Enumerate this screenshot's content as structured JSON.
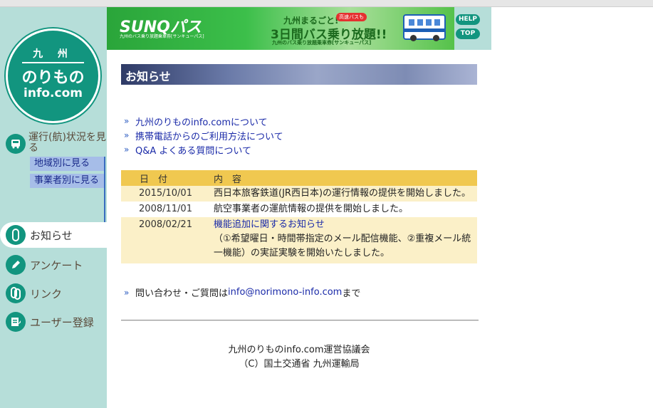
{
  "logo": {
    "line1": "九 州",
    "line2": "のりもの",
    "line3": "info.com"
  },
  "sidebar": {
    "operation": {
      "label": "運行(航)状況を見る",
      "subitems": [
        {
          "label": "地域別に見る"
        },
        {
          "label": "事業者別に見る"
        }
      ]
    },
    "menu": [
      {
        "label": "お知らせ",
        "active": true,
        "icon": "info-icon"
      },
      {
        "label": "アンケート",
        "active": false,
        "icon": "pencil-icon"
      },
      {
        "label": "リンク",
        "active": false,
        "icon": "link-icon"
      },
      {
        "label": "ユーザー登録",
        "active": false,
        "icon": "register-icon"
      }
    ]
  },
  "banner": {
    "brand": "SUNQパス",
    "brand_sub": "九州のバス乗り放題乗車券[サンキューパス]",
    "catch1": "九州まるごと!",
    "pill": "高速バスも",
    "catch2": "3日間バス乗り放題!!",
    "catch3": "九州のバス乗り放題乗車券[サンキューパス]",
    "help": "HELP",
    "top": "TOP"
  },
  "main": {
    "title": "お知らせ",
    "links": [
      {
        "label": "九州のりものinfo.comについて"
      },
      {
        "label": "携帯電話からのご利用方法について"
      },
      {
        "label": "Q&A よくある質問について"
      }
    ],
    "news": {
      "header_date": "日　付",
      "header_content": "内　容",
      "rows": [
        {
          "date": "2015/10/01",
          "content": "西日本旅客鉄道(JR西日本)の運行情報の提供を開始しました。"
        },
        {
          "date": "2008/11/01",
          "content": "航空事業者の運航情報の提供を開始しました。"
        },
        {
          "date": "2008/02/21",
          "link": "機能追加に関するお知らせ",
          "content": "（①希望曜日・時間帯指定のメール配信機能、②重複メール統一機能）の実証実験を開始いたしました。"
        }
      ]
    },
    "contact": {
      "prefix": "問い合わせ・ご質問は",
      "email": "info@norimono-info.com",
      "suffix": "まで"
    },
    "footer": {
      "org": "九州のりものinfo.com運営協議会",
      "copyright": "（C）国土交通省 九州運輸局"
    }
  },
  "colors": {
    "sidebar_bg": "#b6ded9",
    "accent_green": "#12957f",
    "table_header": "#f0c850",
    "table_row": "#fbf0c8",
    "link": "#1a2aa8"
  }
}
